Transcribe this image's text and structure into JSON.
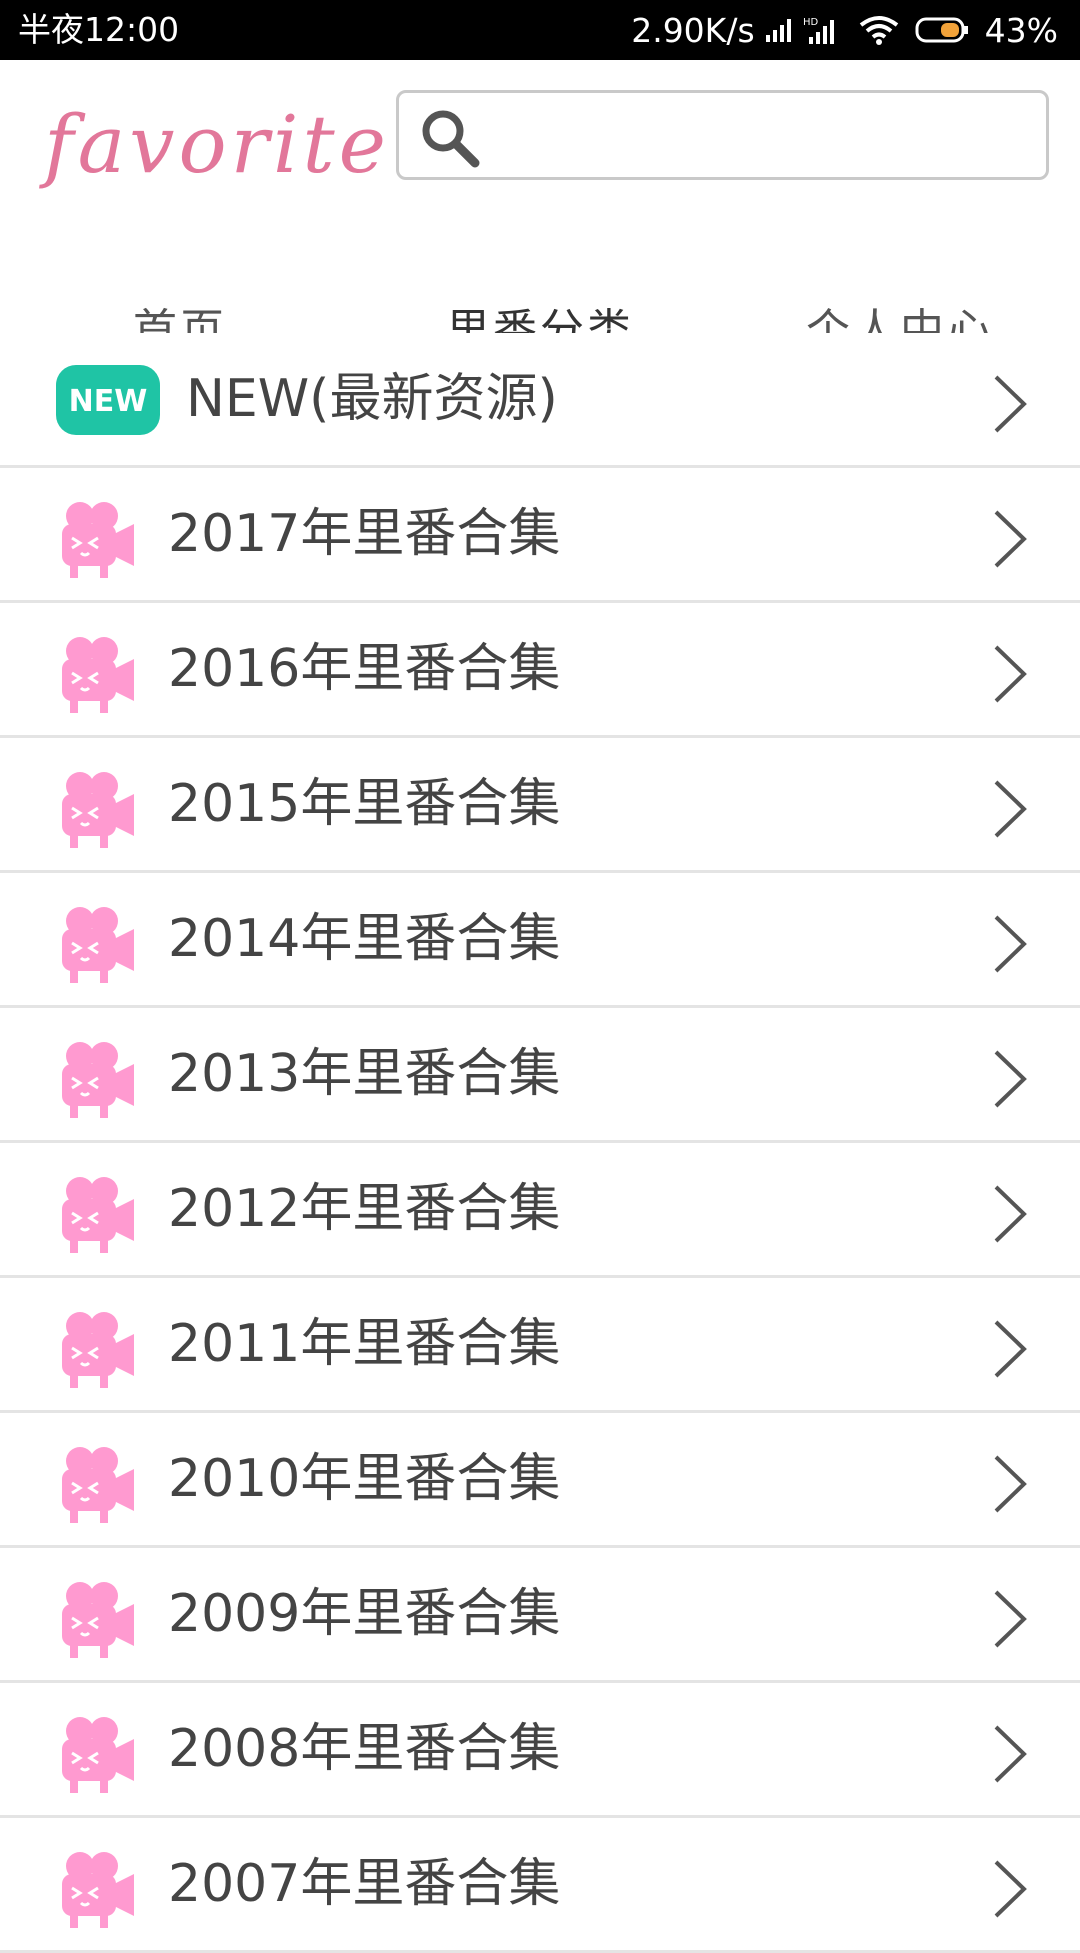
{
  "status_bar": {
    "time": "半夜12:00",
    "speed": "2.90K/s",
    "battery": "43%"
  },
  "header": {
    "logo": "favorite",
    "search": {
      "value": "",
      "placeholder": ""
    }
  },
  "tabs": [
    {
      "label": "首页"
    },
    {
      "label": "里番分类"
    },
    {
      "label": "个人中心"
    }
  ],
  "list": {
    "new_item": {
      "badge": "NEW",
      "label": "NEW(最新资源)"
    },
    "items": [
      {
        "label": "2017年里番合集"
      },
      {
        "label": "2016年里番合集"
      },
      {
        "label": "2015年里番合集"
      },
      {
        "label": "2014年里番合集"
      },
      {
        "label": "2013年里番合集"
      },
      {
        "label": "2012年里番合集"
      },
      {
        "label": "2011年里番合集"
      },
      {
        "label": "2010年里番合集"
      },
      {
        "label": "2009年里番合集"
      },
      {
        "label": "2008年里番合集"
      },
      {
        "label": "2007年里番合集"
      }
    ]
  },
  "colors": {
    "accent": "#e0688f",
    "logo": "#e2779a",
    "new_badge": "#1fc4a5",
    "category_icon": "#ff9ad0"
  },
  "icons": {
    "search": "search-icon",
    "new_badge": "new-badge-icon",
    "category": "movie-camera-icon",
    "chevron": "chevron-right-icon",
    "signal": "signal-icon",
    "wifi": "wifi-icon",
    "battery": "battery-icon"
  }
}
